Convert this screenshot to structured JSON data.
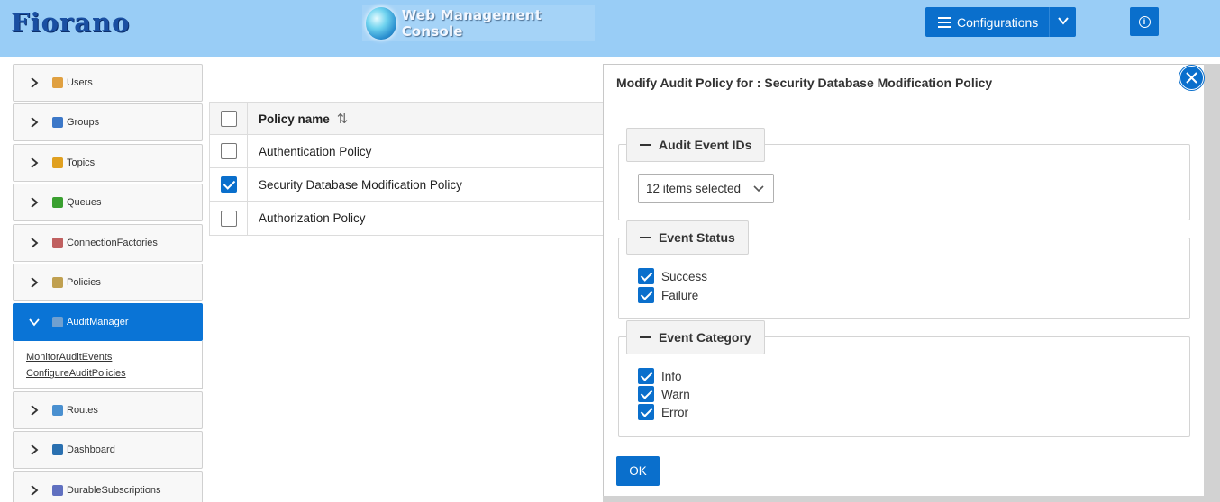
{
  "header": {
    "logo": "Fiorano",
    "console_title": "Web Management Console",
    "configurations_label": "Configurations",
    "info_icon": "info-icon"
  },
  "sidebar": {
    "items": [
      {
        "label": "Users",
        "icon": "user-icon",
        "color": "#e0a040"
      },
      {
        "label": "Groups",
        "icon": "group-icon",
        "color": "#3c78c8"
      },
      {
        "label": "Topics",
        "icon": "topic-icon",
        "color": "#e0a020"
      },
      {
        "label": "Queues",
        "icon": "queue-icon",
        "color": "#3aa030"
      },
      {
        "label": "ConnectionFactories",
        "icon": "connection-factory-icon",
        "color": "#c06060"
      },
      {
        "label": "Policies",
        "icon": "lock-icon",
        "color": "#c0a050"
      },
      {
        "label": "AuditManager",
        "icon": "audit-icon",
        "color": "#70a0d0"
      },
      {
        "label": "Routes",
        "icon": "route-icon",
        "color": "#4a90d0"
      },
      {
        "label": "Dashboard",
        "icon": "globe-icon",
        "color": "#2a70b0"
      },
      {
        "label": "DurableSubscriptions",
        "icon": "subscription-icon",
        "color": "#6070c0"
      }
    ],
    "audit_sub": [
      "MonitorAuditEvents",
      "ConfigureAuditPolicies"
    ]
  },
  "table": {
    "header": "Policy name",
    "rows": [
      {
        "name": "Authentication Policy",
        "checked": false
      },
      {
        "name": "Security Database Modification Policy",
        "checked": true
      },
      {
        "name": "Authorization Policy",
        "checked": false
      }
    ]
  },
  "dialog": {
    "title": "Modify Audit Policy for : Security Database Modification Policy",
    "audit_ids_legend": "Audit Event IDs",
    "audit_ids_value": "12 items selected",
    "status_legend": "Event Status",
    "status_options": [
      "Success",
      "Failure"
    ],
    "category_legend": "Event Category",
    "category_options": [
      "Info",
      "Warn",
      "Error"
    ],
    "ok_label": "OK"
  },
  "colors": {
    "header_bg": "#99cdf6",
    "accent": "#0a6fcc"
  }
}
